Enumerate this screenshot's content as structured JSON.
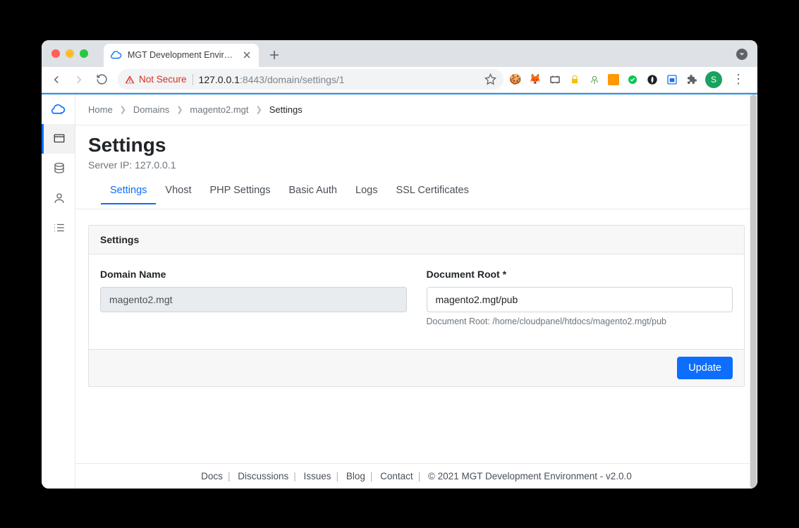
{
  "browser": {
    "tab_title": "MGT Development Environmen",
    "security_label": "Not Secure",
    "url_host": "127.0.0.1",
    "url_rest": ":8443/domain/settings/1",
    "avatar_letter": "S"
  },
  "breadcrumb": {
    "items": [
      "Home",
      "Domains",
      "magento2.mgt",
      "Settings"
    ]
  },
  "page": {
    "title": "Settings",
    "server_ip_label": "Server IP: 127.0.0.1"
  },
  "tabs": {
    "items": [
      "Settings",
      "Vhost",
      "PHP Settings",
      "Basic Auth",
      "Logs",
      "SSL Certificates"
    ],
    "active_index": 0
  },
  "panel": {
    "header": "Settings",
    "domain": {
      "label": "Domain Name",
      "value": "magento2.mgt"
    },
    "docroot": {
      "label": "Document Root *",
      "value": "magento2.mgt/pub",
      "hint": "Document Root: /home/cloudpanel/htdocs/magento2.mgt/pub"
    },
    "submit": "Update"
  },
  "footer": {
    "links": [
      "Docs",
      "Discussions",
      "Issues",
      "Blog",
      "Contact"
    ],
    "copyright": "© 2021 MGT Development Environment - v2.0.0"
  }
}
